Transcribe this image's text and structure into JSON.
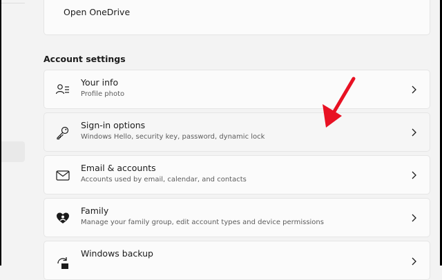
{
  "top_card": {
    "label": "Open OneDrive"
  },
  "section_title": "Account settings",
  "items": [
    {
      "title": "Your info",
      "subtitle": "Profile photo",
      "icon": "profile-icon"
    },
    {
      "title": "Sign-in options",
      "subtitle": "Windows Hello, security key, password, dynamic lock",
      "icon": "key-icon"
    },
    {
      "title": "Email & accounts",
      "subtitle": "Accounts used by email, calendar, and contacts",
      "icon": "mail-icon"
    },
    {
      "title": "Family",
      "subtitle": "Manage your family group, edit account types and device permissions",
      "icon": "family-heart-icon"
    },
    {
      "title": "Windows backup",
      "subtitle": "",
      "icon": "backup-icon"
    }
  ],
  "annotation": {
    "color": "#e81123",
    "icon": "red-arrow-icon"
  }
}
